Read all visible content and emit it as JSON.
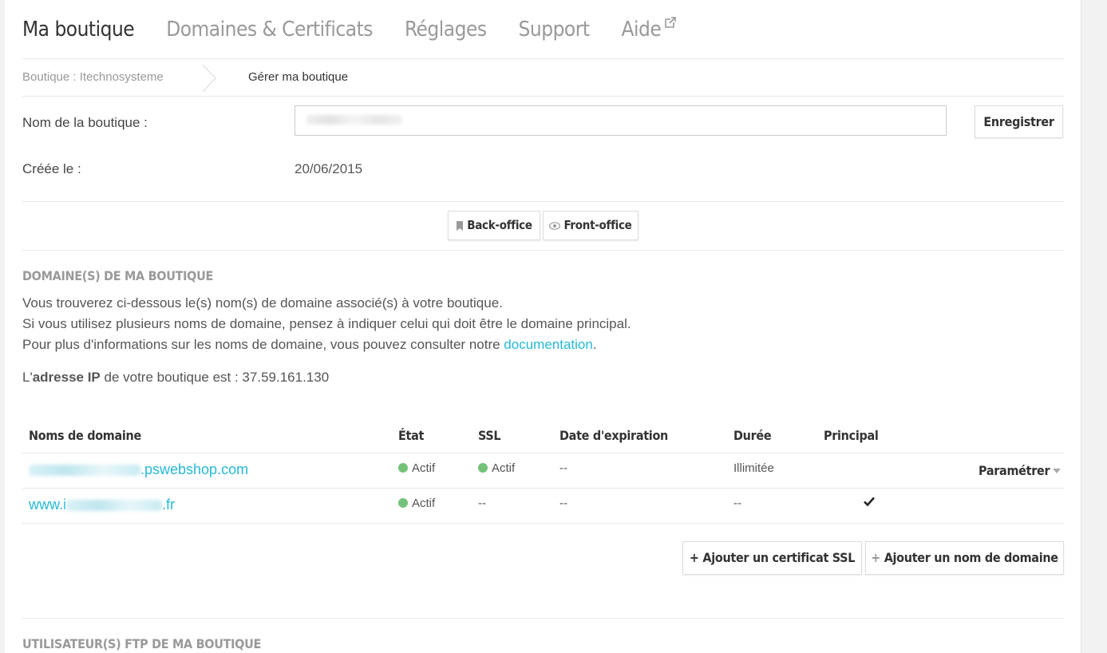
{
  "nav": {
    "tabs": [
      "Ma boutique",
      "Domaines & Certificats",
      "Réglages",
      "Support",
      "Aide"
    ],
    "active": 0
  },
  "breadcrumb": {
    "parent": "Boutique : Itechnosysteme",
    "current": "Gérer ma boutique"
  },
  "form": {
    "name_label": "Nom de la boutique :",
    "save_label": "Enregistrer",
    "created_label": "Créée le :",
    "created_value": "20/06/2015"
  },
  "office": {
    "back_label": "Back-office",
    "front_label": "Front-office"
  },
  "domains": {
    "title": "DOMAINE(S) DE MA BOUTIQUE",
    "line1": "Vous trouverez ci-dessous le(s) nom(s) de domaine associé(s) à votre boutique.",
    "line2": "Si vous utilisez plusieurs noms de domaine, pensez à indiquer celui qui doit être le domaine principal.",
    "line3_prefix": "Pour plus d'informations sur les noms de domaine, vous pouvez consulter notre ",
    "line3_link": "documentation",
    "line3_suffix": ".",
    "ip_prefix": "L'",
    "ip_bold": "adresse IP",
    "ip_suffix": " de votre boutique est : 37.59.161.130"
  },
  "table": {
    "headers": [
      "Noms de domaine",
      "État",
      "SSL",
      "Date d'expiration",
      "Durée",
      "Principal"
    ],
    "rows": [
      {
        "domain_visible": ".pswebshop.com",
        "state": "Actif",
        "ssl": "Actif",
        "expiration": "--",
        "duration": "Illimitée",
        "principal": false,
        "action": "Paramétrer"
      },
      {
        "domain_prefix": "www.i",
        "domain_visible": ".fr",
        "state": "Actif",
        "ssl": "--",
        "expiration": "--",
        "duration": "--",
        "principal": true
      }
    ]
  },
  "actions": {
    "add_ssl": "+ Ajouter un certificat SSL",
    "add_domain": "Ajouter un nom de domaine"
  },
  "ftp": {
    "title": "UTILISATEUR(S) FTP DE MA BOUTIQUE"
  },
  "colors": {
    "accent": "#25b9d7",
    "status_green": "#72c279"
  }
}
